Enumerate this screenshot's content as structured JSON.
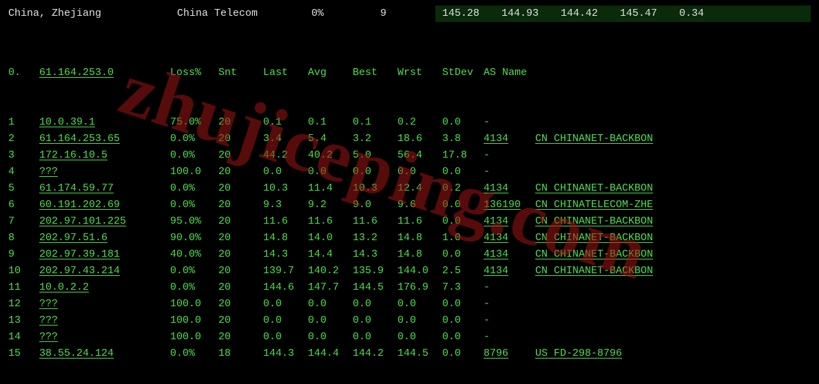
{
  "top": {
    "location": "China, Zhejiang",
    "isp": "China Telecom",
    "percent": "0%",
    "count": "9",
    "metrics": [
      "145.28",
      "144.93",
      "144.42",
      "145.47",
      "0.34"
    ]
  },
  "headers": {
    "idx": "0.",
    "host": "61.164.253.0",
    "loss": "Loss%",
    "snt": "Snt",
    "last": "Last",
    "avg": "Avg",
    "best": "Best",
    "wrst": "Wrst",
    "stdev": "StDev",
    "asname": "AS Name"
  },
  "hops": [
    {
      "idx": "1",
      "host": "10.0.39.1",
      "loss": "75.0%",
      "snt": "20",
      "last": "0.1",
      "avg": "0.1",
      "best": "0.1",
      "wrst": "0.2",
      "stdev": "0.0",
      "as": "-",
      "name": ""
    },
    {
      "idx": "2",
      "host": "61.164.253.65",
      "loss": "0.0%",
      "snt": "20",
      "last": "3.4",
      "avg": "5.4",
      "best": "3.2",
      "wrst": "18.6",
      "stdev": "3.8",
      "as": "4134",
      "name": "CN CHINANET-BACKBON"
    },
    {
      "idx": "3",
      "host": "172.16.10.5",
      "loss": "0.0%",
      "snt": "20",
      "last": "44.2",
      "avg": "40.2",
      "best": "5.0",
      "wrst": "56.4",
      "stdev": "17.8",
      "as": "-",
      "name": ""
    },
    {
      "idx": "4",
      "host": "???",
      "loss": "100.0",
      "snt": "20",
      "last": "0.0",
      "avg": "0.0",
      "best": "0.0",
      "wrst": "0.0",
      "stdev": "0.0",
      "as": "-",
      "name": ""
    },
    {
      "idx": "5",
      "host": "61.174.59.77",
      "loss": "0.0%",
      "snt": "20",
      "last": "10.3",
      "avg": "11.4",
      "best": "10.3",
      "wrst": "12.4",
      "stdev": "0.2",
      "as": "4134",
      "name": "CN CHINANET-BACKBON"
    },
    {
      "idx": "6",
      "host": "60.191.202.69",
      "loss": "0.0%",
      "snt": "20",
      "last": "9.3",
      "avg": "9.2",
      "best": "9.0",
      "wrst": "9.6",
      "stdev": "0.0",
      "as": "136190",
      "name": "CN CHINATELECOM-ZHE"
    },
    {
      "idx": "7",
      "host": "202.97.101.225",
      "loss": "95.0%",
      "snt": "20",
      "last": "11.6",
      "avg": "11.6",
      "best": "11.6",
      "wrst": "11.6",
      "stdev": "0.0",
      "as": "4134",
      "name": "CN CHINANET-BACKBON"
    },
    {
      "idx": "8",
      "host": "202.97.51.6",
      "loss": "90.0%",
      "snt": "20",
      "last": "14.8",
      "avg": "14.0",
      "best": "13.2",
      "wrst": "14.8",
      "stdev": "1.0",
      "as": "4134",
      "name": "CN CHINANET-BACKBON"
    },
    {
      "idx": "9",
      "host": "202.97.39.181",
      "loss": "40.0%",
      "snt": "20",
      "last": "14.3",
      "avg": "14.4",
      "best": "14.3",
      "wrst": "14.8",
      "stdev": "0.0",
      "as": "4134",
      "name": "CN CHINANET-BACKBON"
    },
    {
      "idx": "10",
      "host": "202.97.43.214",
      "loss": "0.0%",
      "snt": "20",
      "last": "139.7",
      "avg": "140.2",
      "best": "135.9",
      "wrst": "144.0",
      "stdev": "2.5",
      "as": "4134",
      "name": "CN CHINANET-BACKBON"
    },
    {
      "idx": "11",
      "host": "10.0.2.2",
      "loss": "0.0%",
      "snt": "20",
      "last": "144.6",
      "avg": "147.7",
      "best": "144.5",
      "wrst": "176.9",
      "stdev": "7.3",
      "as": "-",
      "name": ""
    },
    {
      "idx": "12",
      "host": "???",
      "loss": "100.0",
      "snt": "20",
      "last": "0.0",
      "avg": "0.0",
      "best": "0.0",
      "wrst": "0.0",
      "stdev": "0.0",
      "as": "-",
      "name": ""
    },
    {
      "idx": "13",
      "host": "???",
      "loss": "100.0",
      "snt": "20",
      "last": "0.0",
      "avg": "0.0",
      "best": "0.0",
      "wrst": "0.0",
      "stdev": "0.0",
      "as": "-",
      "name": ""
    },
    {
      "idx": "14",
      "host": "???",
      "loss": "100.0",
      "snt": "20",
      "last": "0.0",
      "avg": "0.0",
      "best": "0.0",
      "wrst": "0.0",
      "stdev": "0.0",
      "as": "-",
      "name": ""
    },
    {
      "idx": "15",
      "host": "38.55.24.124",
      "loss": "0.0%",
      "snt": "18",
      "last": "144.3",
      "avg": "144.4",
      "best": "144.2",
      "wrst": "144.5",
      "stdev": "0.0",
      "as": "8796",
      "name": "US FD-298-8796"
    }
  ],
  "watermark": "zhujiceping.com"
}
